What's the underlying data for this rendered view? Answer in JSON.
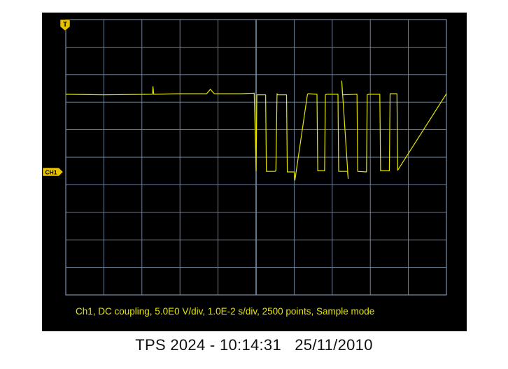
{
  "chart_data": {
    "type": "line",
    "title": "",
    "xlabel": "",
    "ylabel": "",
    "x_unit": "s",
    "y_unit": "V",
    "ylim": [
      -20,
      25
    ],
    "xlim": [
      -0.05,
      0.05
    ],
    "grid": true,
    "grid_divisions": {
      "x": 10,
      "y": 10
    },
    "trigger_marker": "T",
    "channel_marker": "CH1",
    "settings_text": "Ch1, DC coupling, 5.0E0 V/div, 1.0E-2 s/div, 2500 points, Sample mode",
    "series": [
      {
        "color": "#e6e600",
        "x": [
          -0.05,
          -0.04,
          -0.0272,
          -0.0271,
          -0.0269,
          -0.02,
          -0.013,
          -0.012,
          -0.011,
          -0.004,
          -0.0005,
          0.0,
          0.0002,
          0.0025,
          0.0027,
          0.005,
          0.0052,
          0.0055,
          0.0057,
          0.008,
          0.0082,
          0.01,
          0.0102,
          0.0135,
          0.0137,
          0.016,
          0.0162,
          0.018,
          0.0182,
          0.0185,
          0.0187,
          0.0215,
          0.0217,
          0.024,
          0.0242,
          0.0225,
          0.0227,
          0.0227,
          0.0265,
          0.0267,
          0.029,
          0.0292,
          0.0295,
          0.0297,
          0.0325,
          0.0327,
          0.035,
          0.0352,
          0.037,
          0.0372,
          0.05
        ],
        "values": [
          14.1,
          14.0,
          14.1,
          15.5,
          14.1,
          14.2,
          14.2,
          15.0,
          14.2,
          14.2,
          14.3,
          0.2,
          14.0,
          14.0,
          0.1,
          0.1,
          0.3,
          14.2,
          14.0,
          14.0,
          0.0,
          0.0,
          -1.5,
          14.1,
          14.2,
          14.1,
          0.2,
          0.2,
          14.0,
          14.1,
          14.1,
          14.1,
          0.1,
          0.1,
          -1.2,
          16.5,
          14.0,
          14.0,
          14.1,
          0.1,
          0.0,
          14.0,
          14.1,
          14.1,
          14.1,
          0.2,
          0.2,
          14.2,
          14.2,
          0.3,
          14.2
        ]
      }
    ]
  },
  "caption": {
    "model_time": "TPS 2024 - 10:14:31",
    "date": "25/11/2010"
  },
  "colors": {
    "background": "#000000",
    "grid": "#7a90a8",
    "trace": "#e6e600",
    "marker_fill": "#e6c200"
  }
}
